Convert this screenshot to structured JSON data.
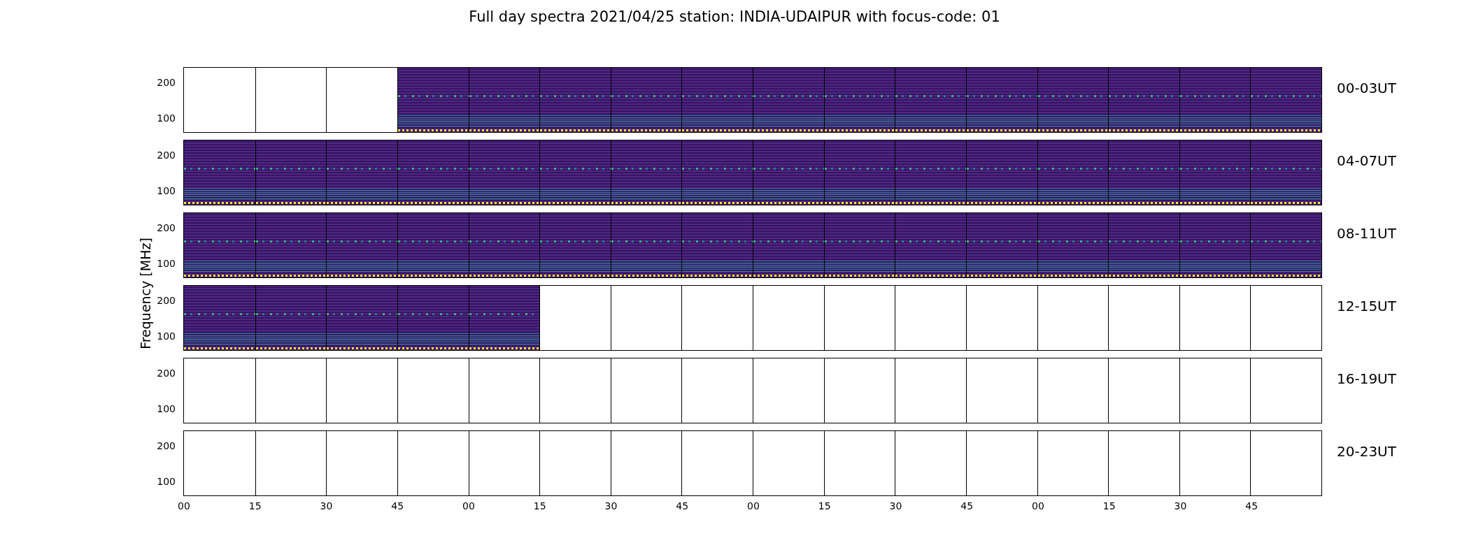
{
  "title": "Full day spectra 2021/04/25 station: INDIA-UDAIPUR with focus-code: 01",
  "ylabel": "Frequency [MHz]",
  "rows": [
    {
      "label": "00-03UT",
      "yticks": [
        "200",
        "100"
      ],
      "panels": [
        {
          "kind": "empty"
        },
        {
          "kind": "empty"
        },
        {
          "kind": "empty"
        },
        {
          "kind": "spectrogram"
        },
        {
          "kind": "spectrogram"
        },
        {
          "kind": "spectrogram"
        },
        {
          "kind": "spectrogram"
        },
        {
          "kind": "spectrogram"
        },
        {
          "kind": "spectrogram"
        },
        {
          "kind": "spectrogram"
        },
        {
          "kind": "spectrogram"
        },
        {
          "kind": "spectrogram"
        },
        {
          "kind": "spectrogram"
        },
        {
          "kind": "spectrogram"
        },
        {
          "kind": "spectrogram"
        },
        {
          "kind": "spectrogram"
        }
      ]
    },
    {
      "label": "04-07UT",
      "yticks": [
        "200",
        "100"
      ],
      "panels": [
        {
          "kind": "spectrogram"
        },
        {
          "kind": "spectrogram"
        },
        {
          "kind": "spectrogram"
        },
        {
          "kind": "spectrogram"
        },
        {
          "kind": "spectrogram"
        },
        {
          "kind": "spectrogram"
        },
        {
          "kind": "spectrogram"
        },
        {
          "kind": "spectrogram"
        },
        {
          "kind": "spectrogram"
        },
        {
          "kind": "spectrogram"
        },
        {
          "kind": "spectrogram"
        },
        {
          "kind": "spectrogram"
        },
        {
          "kind": "spectrogram"
        },
        {
          "kind": "spectrogram"
        },
        {
          "kind": "spectrogram"
        },
        {
          "kind": "spectrogram"
        }
      ]
    },
    {
      "label": "08-11UT",
      "yticks": [
        "200",
        "100"
      ],
      "panels": [
        {
          "kind": "spectrogram"
        },
        {
          "kind": "spectrogram"
        },
        {
          "kind": "spectrogram"
        },
        {
          "kind": "spectrogram"
        },
        {
          "kind": "spectrogram"
        },
        {
          "kind": "spectrogram"
        },
        {
          "kind": "spectrogram"
        },
        {
          "kind": "spectrogram"
        },
        {
          "kind": "spectrogram"
        },
        {
          "kind": "spectrogram"
        },
        {
          "kind": "spectrogram"
        },
        {
          "kind": "spectrogram"
        },
        {
          "kind": "spectrogram"
        },
        {
          "kind": "spectrogram"
        },
        {
          "kind": "spectrogram"
        },
        {
          "kind": "spectrogram"
        }
      ]
    },
    {
      "label": "12-15UT",
      "yticks": [
        "200",
        "100"
      ],
      "panels": [
        {
          "kind": "spectrogram"
        },
        {
          "kind": "spectrogram"
        },
        {
          "kind": "spectrogram"
        },
        {
          "kind": "spectrogram"
        },
        {
          "kind": "spectrogram"
        },
        {
          "kind": "empty"
        },
        {
          "kind": "empty"
        },
        {
          "kind": "empty"
        },
        {
          "kind": "empty"
        },
        {
          "kind": "empty"
        },
        {
          "kind": "empty"
        },
        {
          "kind": "empty"
        },
        {
          "kind": "empty"
        },
        {
          "kind": "empty"
        },
        {
          "kind": "empty"
        },
        {
          "kind": "empty"
        }
      ]
    },
    {
      "label": "16-19UT",
      "yticks": [
        "200",
        "100"
      ],
      "panels": [
        {
          "kind": "empty"
        },
        {
          "kind": "empty"
        },
        {
          "kind": "empty"
        },
        {
          "kind": "empty"
        },
        {
          "kind": "empty"
        },
        {
          "kind": "empty"
        },
        {
          "kind": "empty"
        },
        {
          "kind": "empty"
        },
        {
          "kind": "empty"
        },
        {
          "kind": "empty"
        },
        {
          "kind": "empty"
        },
        {
          "kind": "empty"
        },
        {
          "kind": "empty"
        },
        {
          "kind": "empty"
        },
        {
          "kind": "empty"
        },
        {
          "kind": "empty"
        }
      ]
    },
    {
      "label": "20-23UT",
      "yticks": [
        "200",
        "100"
      ],
      "panels": [
        {
          "kind": "empty"
        },
        {
          "kind": "empty"
        },
        {
          "kind": "empty"
        },
        {
          "kind": "empty"
        },
        {
          "kind": "empty"
        },
        {
          "kind": "empty"
        },
        {
          "kind": "empty"
        },
        {
          "kind": "empty"
        },
        {
          "kind": "empty"
        },
        {
          "kind": "empty"
        },
        {
          "kind": "empty"
        },
        {
          "kind": "empty"
        },
        {
          "kind": "empty"
        },
        {
          "kind": "empty"
        },
        {
          "kind": "empty"
        },
        {
          "kind": "empty"
        }
      ]
    }
  ],
  "xticks": [
    "00",
    "15",
    "30",
    "45",
    "00",
    "15",
    "30",
    "45",
    "00",
    "15",
    "30",
    "45",
    "00",
    "15",
    "30",
    "45"
  ]
}
